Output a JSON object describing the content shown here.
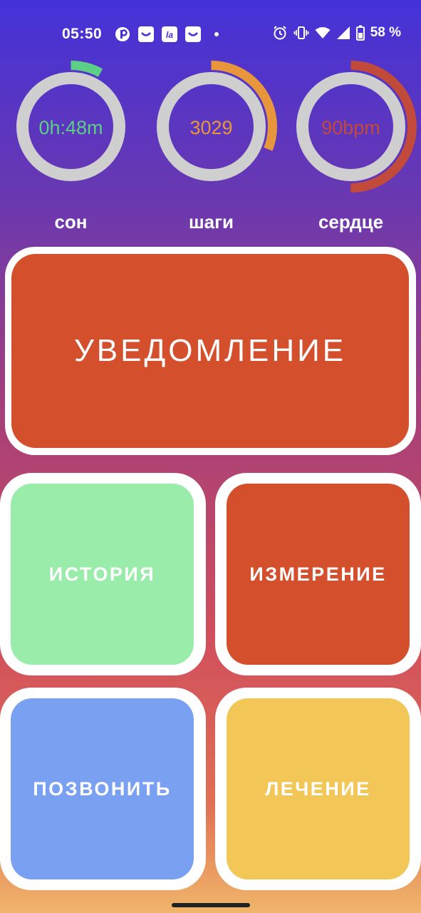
{
  "status_bar": {
    "time": "05:50",
    "battery": "58 %",
    "icons": [
      "p-app-icon",
      "ozon-icon",
      "la-app-icon",
      "ozon-icon",
      "dot-icon",
      "alarm-icon",
      "vibrate-icon",
      "wifi-icon",
      "signal-icon",
      "battery-icon"
    ]
  },
  "metrics": [
    {
      "label": "сон",
      "value": "0h:48m",
      "color": "#5ccf86",
      "progress": 0.08
    },
    {
      "label": "шаги",
      "value": "3029",
      "color": "#e8963c",
      "progress": 0.31
    },
    {
      "label": "сердце",
      "value": "90bpm",
      "color": "#c24a3a",
      "progress": 0.5
    }
  ],
  "tiles": {
    "notification": {
      "label": "УВЕДОМЛЕНИЕ",
      "color": "#d44f2c"
    },
    "history": {
      "label": "ИСТОРИЯ",
      "color": "#9aecaa"
    },
    "measurement": {
      "label": "ИЗМЕРЕНИЕ",
      "color": "#d44f2c"
    },
    "call": {
      "label": "ПОЗВОНИТЬ",
      "color": "#7aa0f2"
    },
    "treatment": {
      "label": "ЛЕЧЕНИЕ",
      "color": "#f2c657"
    }
  }
}
